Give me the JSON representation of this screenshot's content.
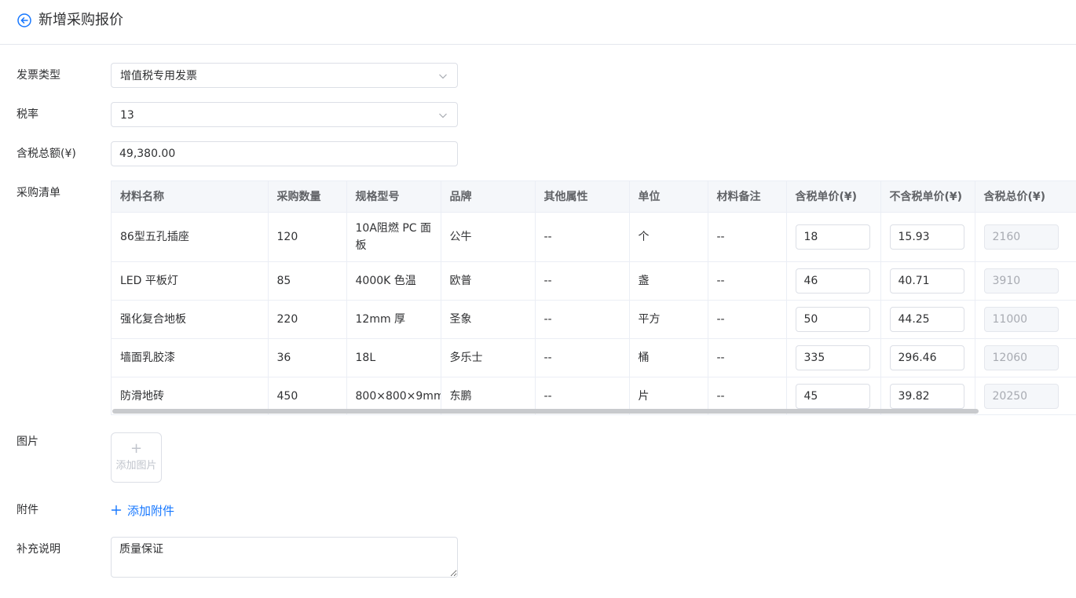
{
  "header": {
    "title": "新增采购报价"
  },
  "form": {
    "invoice_type": {
      "label": "发票类型",
      "value": "增值税专用发票"
    },
    "tax_rate": {
      "label": "税率",
      "value": "13"
    },
    "total_with_tax": {
      "label": "含税总额(¥)",
      "value": "49,380.00"
    },
    "purchase_list": {
      "label": "采购清单"
    },
    "images": {
      "label": "图片",
      "add_text": "添加图片"
    },
    "attachments": {
      "label": "附件",
      "add_text": "添加附件"
    },
    "remarks": {
      "label": "补充说明",
      "value": "质量保证"
    }
  },
  "table": {
    "columns": [
      "材料名称",
      "采购数量",
      "规格型号",
      "品牌",
      "其他属性",
      "单位",
      "材料备注",
      "含税单价(¥)",
      "不含税单价(¥)",
      "含税总价(¥)"
    ],
    "rows": [
      {
        "name": "86型五孔插座",
        "qty": "120",
        "spec": "10A阻燃 PC 面板",
        "brand": "公牛",
        "other": "--",
        "unit": "个",
        "note": "--",
        "price_tax": "18",
        "price_no_tax": "15.93",
        "total": "2160"
      },
      {
        "name": "LED 平板灯",
        "qty": "85",
        "spec": "4000K 色温",
        "brand": "欧普",
        "other": "--",
        "unit": "盏",
        "note": "--",
        "price_tax": "46",
        "price_no_tax": "40.71",
        "total": "3910"
      },
      {
        "name": "强化复合地板",
        "qty": "220",
        "spec": "12mm 厚",
        "brand": "圣象",
        "other": "--",
        "unit": "平方",
        "note": "--",
        "price_tax": "50",
        "price_no_tax": "44.25",
        "total": "11000"
      },
      {
        "name": "墙面乳胶漆",
        "qty": "36",
        "spec": "18L",
        "brand": "多乐士",
        "other": "--",
        "unit": "桶",
        "note": "--",
        "price_tax": "335",
        "price_no_tax": "296.46",
        "total": "12060"
      },
      {
        "name": "防滑地砖",
        "qty": "450",
        "spec": "800×800×9mm",
        "brand": "东鹏",
        "other": "--",
        "unit": "片",
        "note": "--",
        "price_tax": "45",
        "price_no_tax": "39.82",
        "total": "20250"
      }
    ]
  },
  "icons": {
    "back": "back-circle-icon",
    "chevron": "chevron-down-icon",
    "plus": "plus-icon"
  },
  "colors": {
    "primary": "#1677ff",
    "border": "#dcdfe6",
    "header_bg": "#f5f7fa"
  }
}
